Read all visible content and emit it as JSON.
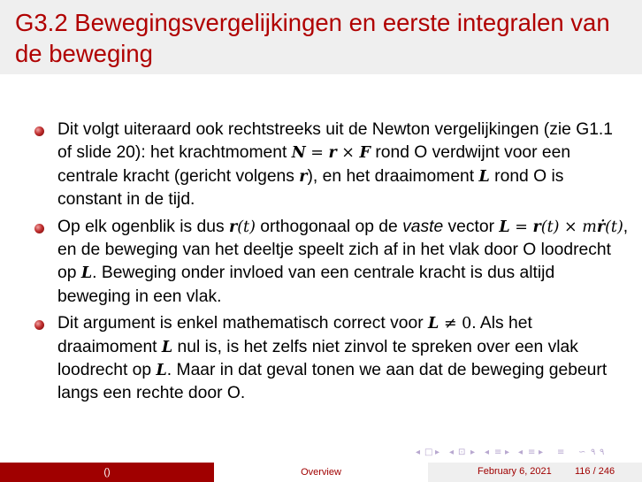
{
  "slide": {
    "title": "G3.2 Bewegingsvergelijkingen en eerste integralen van de beweging"
  },
  "bullets": [
    {
      "t1": "Dit volgt uiteraard ook rechtstreeks uit de Newton vergelijkingen (zie G1.1 of slide 20): het krachtmoment ",
      "m1": "N",
      "m2": " = ",
      "m3": "r",
      "m4": " × ",
      "m5": "F",
      "t2": " rond O verdwijnt voor een centrale kracht (gericht volgens ",
      "m6": "r",
      "t3": "), en het draaimoment ",
      "m7": "L",
      "t4": " rond O is constant in de tijd."
    },
    {
      "t1": "Op elk ogenblik is dus ",
      "m1": "r",
      "m2": "(t)",
      "t2": " orthogonaal op de ",
      "t3": "vaste",
      "t4": " vector ",
      "m3": "L",
      "m4": " = ",
      "m5": "r",
      "m6": "(t) × m",
      "m7": "ṙ",
      "m8": "(t)",
      "t5": ", en de beweging van het deeltje speelt zich af in het vlak door O loodrecht op ",
      "m9": "L",
      "t6": ". Beweging onder invloed van een centrale kracht is dus altijd beweging in een vlak."
    },
    {
      "t1": "Dit argument is enkel mathematisch correct voor ",
      "m1": "L",
      "m2": " ≠ 0",
      "t2": ". Als het draaimoment ",
      "m3": "L",
      "t3": " nul is, is het zelfs niet zinvol te spreken over een vlak loodrecht op ",
      "m4": "L",
      "t4": ". Maar in dat geval tonen we aan dat de beweging gebeurt langs een rechte door O."
    }
  ],
  "nav": {
    "symbols": [
      "◂",
      "□",
      "▸",
      "◂",
      "⊡",
      "▸",
      "◂",
      "≡",
      "▸",
      "◂",
      "≡",
      "▸",
      "≡",
      "∽",
      "۹",
      "۹"
    ]
  },
  "footer": {
    "author": "()",
    "section": "Overview",
    "date": "February 6, 2021",
    "page": "116 / 246"
  },
  "colors": {
    "title": "#b00000",
    "footer_left_bg": "#a00000",
    "bullet": "#c03030"
  }
}
